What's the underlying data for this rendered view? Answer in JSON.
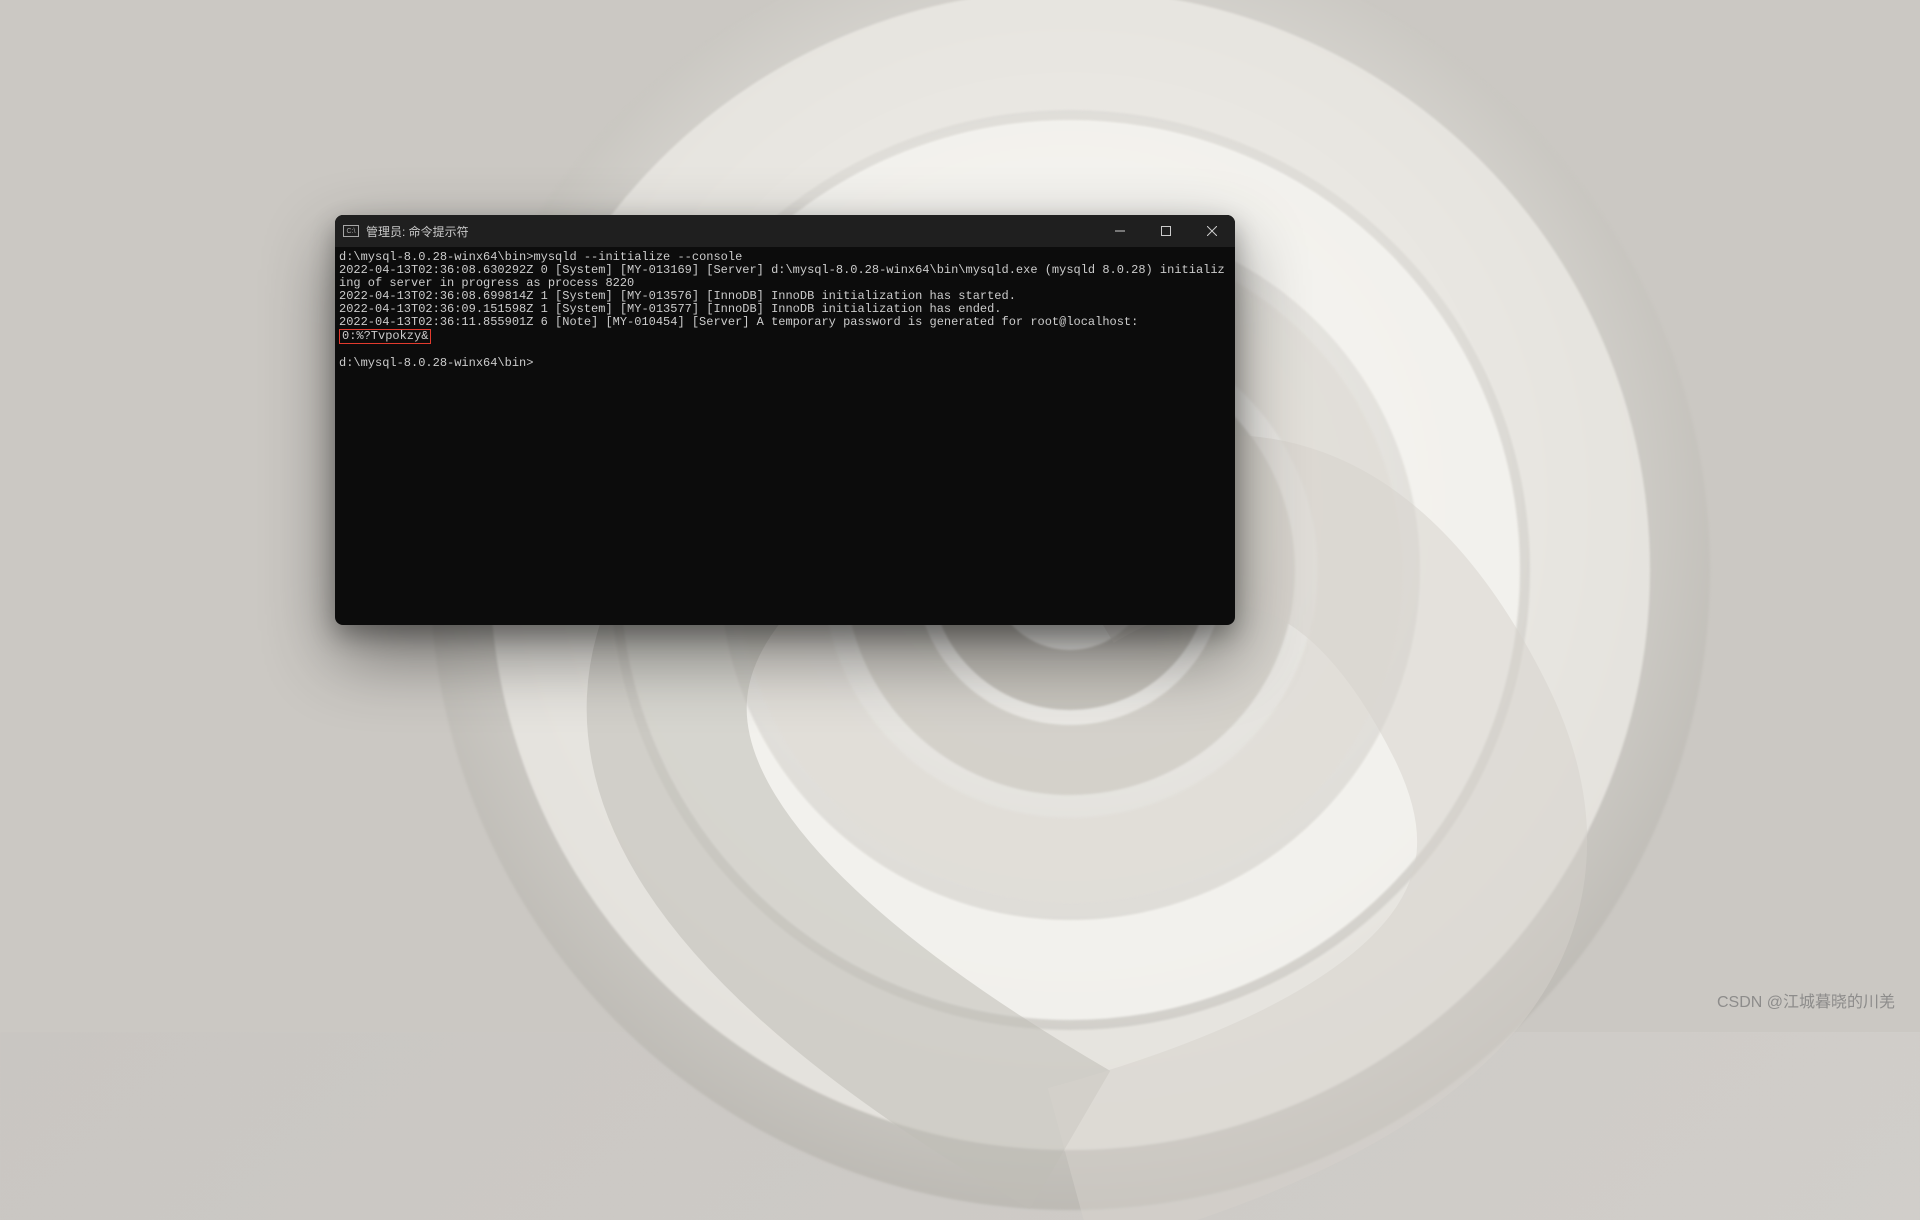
{
  "window": {
    "icon_glyph": "C:\\",
    "title": "管理员: 命令提示符"
  },
  "controls": {
    "minimize_name": "minimize",
    "maximize_name": "maximize",
    "close_name": "close"
  },
  "terminal": {
    "prompt1": "d:\\mysql-8.0.28-winx64\\bin>",
    "cmd1": "mysqld --initialize --console",
    "line1": "2022-04-13T02:36:08.630292Z 0 [System] [MY-013169] [Server] d:\\mysql-8.0.28-winx64\\bin\\mysqld.exe (mysqld 8.0.28) initializing of server in progress as process 8220",
    "line2": "2022-04-13T02:36:08.699814Z 1 [System] [MY-013576] [InnoDB] InnoDB initialization has started.",
    "line3": "2022-04-13T02:36:09.151598Z 1 [System] [MY-013577] [InnoDB] InnoDB initialization has ended.",
    "line4_prefix": "2022-04-13T02:36:11.855901Z 6 [Note] [MY-010454] [Server] A temporary password is generated for root@localhost: ",
    "password_highlight": "0:%?Tvpokzy&",
    "prompt2": "d:\\mysql-8.0.28-winx64\\bin>"
  },
  "watermark": "CSDN @江城暮晓的川羌"
}
